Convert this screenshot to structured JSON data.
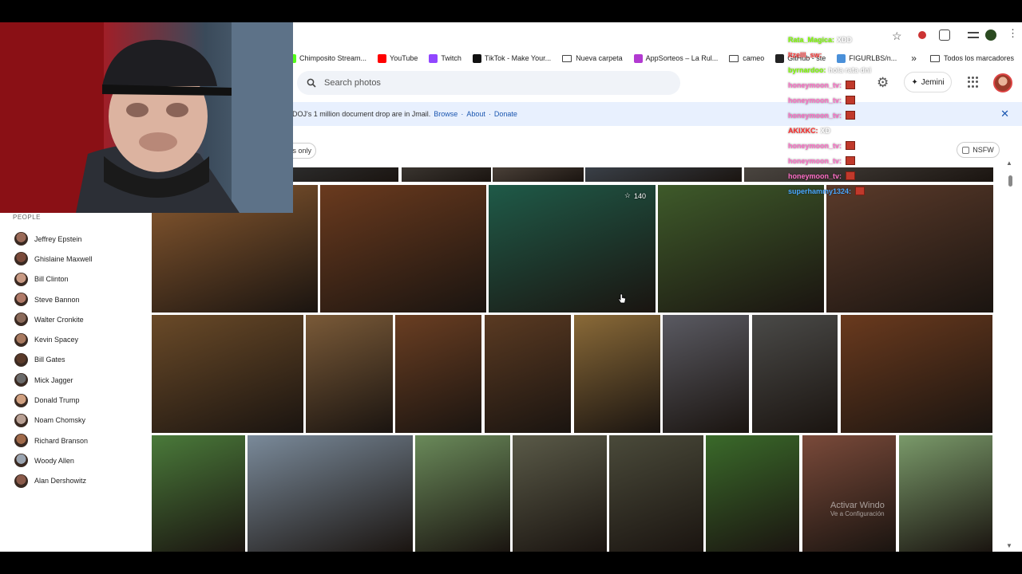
{
  "colors": {
    "accent": "#1a56b0",
    "banner_bg": "#e8f0fe"
  },
  "bookmarks": [
    {
      "label": "Chimposito Stream...",
      "icon": "kick-icon",
      "color": "#53fc18"
    },
    {
      "label": "YouTube",
      "icon": "youtube-icon",
      "color": "#ff0000"
    },
    {
      "label": "Twitch",
      "icon": "twitch-icon",
      "color": "#9146ff"
    },
    {
      "label": "TikTok - Make Your...",
      "icon": "tiktok-icon",
      "color": "#111111"
    },
    {
      "label": "Nueva carpeta",
      "icon": "folder-icon"
    },
    {
      "label": "AppSorteos – La Rul...",
      "icon": "appsorteos-icon",
      "color": "#b23ad1"
    },
    {
      "label": "cameo",
      "icon": "folder-icon"
    },
    {
      "label": "GitHub - ste",
      "icon": "github-icon",
      "color": "#222222"
    },
    {
      "label": "FIGURLBS/n...",
      "icon": "bookmark-icon",
      "color": "#4a90d9"
    }
  ],
  "bookmarks_more": "»",
  "all_bookmarks": "Todos los marcadores",
  "search": {
    "placeholder": "Search photos"
  },
  "gemini_label": "Jemini",
  "banner": {
    "text": "DOJ's 1 million document drop are in Jmail.",
    "link_browse": "Browse",
    "link_about": "About",
    "link_donate": "Donate",
    "close": "✕"
  },
  "filter_partial": "s only",
  "nsfw_label": "NSFW",
  "people_heading": "PEOPLE",
  "people": [
    {
      "name": "Jeffrey Epstein",
      "color": "#9a6a58"
    },
    {
      "name": "Ghislaine Maxwell",
      "color": "#7a4a3a"
    },
    {
      "name": "Bill Clinton",
      "color": "#c89a84"
    },
    {
      "name": "Steve Bannon",
      "color": "#b07a68"
    },
    {
      "name": "Walter Cronkite",
      "color": "#8a6a5a"
    },
    {
      "name": "Kevin Spacey",
      "color": "#a87a60"
    },
    {
      "name": "Bill Gates",
      "color": "#5a3a2a"
    },
    {
      "name": "Mick Jagger",
      "color": "#6a6a6a"
    },
    {
      "name": "Donald Trump",
      "color": "#d0a080"
    },
    {
      "name": "Noam Chomsky",
      "color": "#b8a094"
    },
    {
      "name": "Richard Branson",
      "color": "#a06a4a"
    },
    {
      "name": "Woody Allen",
      "color": "#9aa4b0"
    },
    {
      "name": "Alan Dershowitz",
      "color": "#8a5a4a"
    }
  ],
  "photo_badge": "140",
  "chat": [
    {
      "user": "Rata_Magica:",
      "msg": "XDD",
      "color": "#7fff00"
    },
    {
      "user": "Itzelll_sw:",
      "msg": "",
      "color": "#ff3b3b"
    },
    {
      "user": "byrnardoo:",
      "msg": "hola rata dni",
      "color": "#7fff00"
    },
    {
      "user": "honeymoon_tv:",
      "msg": "",
      "color": "#ff6ec7",
      "emote": true
    },
    {
      "user": "honeymoon_tv:",
      "msg": "",
      "color": "#ff6ec7",
      "emote": true
    },
    {
      "user": "honeymoon_tv:",
      "msg": "",
      "color": "#ff6ec7",
      "emote": true
    },
    {
      "user": "AKIXKC:",
      "msg": "XD",
      "color": "#ff2d2d"
    },
    {
      "user": "honeymoon_tv:",
      "msg": "",
      "color": "#ff6ec7",
      "emote": true
    },
    {
      "user": "honeymoon_tv:",
      "msg": "",
      "color": "#ff6ec7",
      "emote": true
    },
    {
      "user": "honeymoon_tv:",
      "msg": "",
      "color": "#ff6ec7",
      "emote": true
    },
    {
      "user": "superhammy1324:",
      "msg": "",
      "color": "#4aa8ff",
      "emote": true
    }
  ],
  "watermark": {
    "line1": "Activar Windo",
    "line2": "Ve a Configuración"
  }
}
